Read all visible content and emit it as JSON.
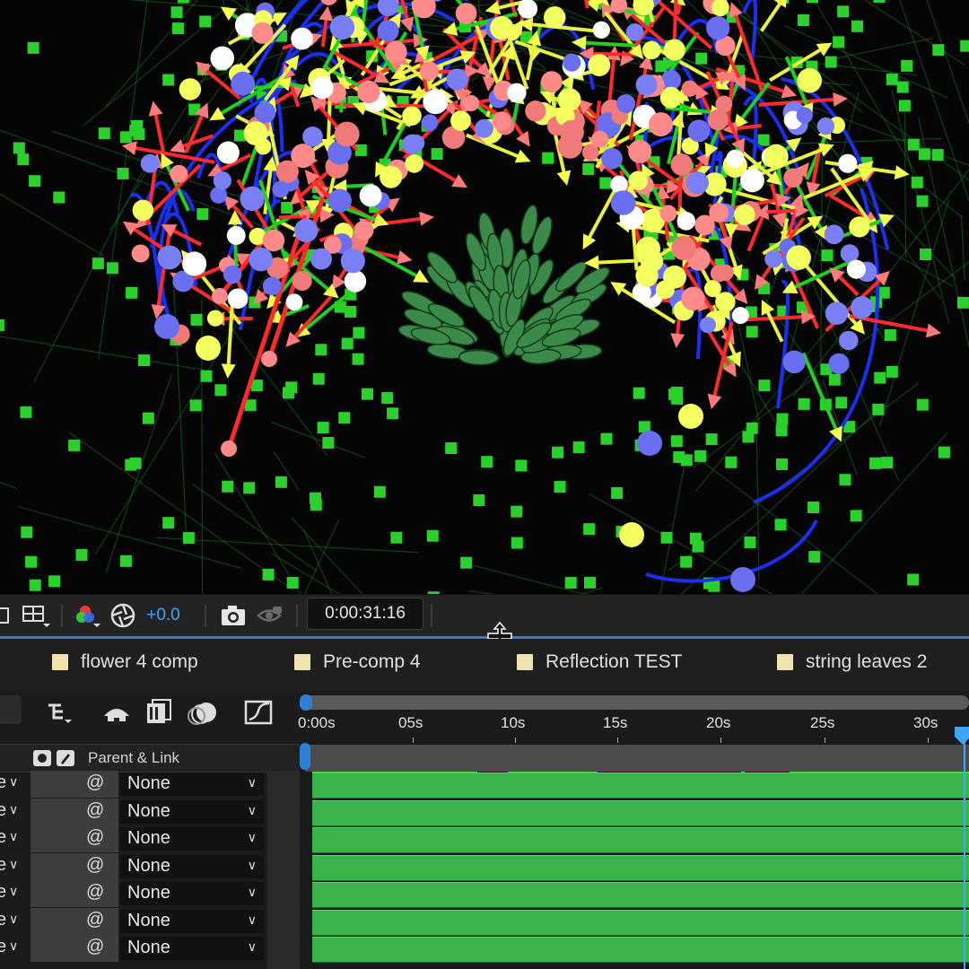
{
  "viewer_toolbar": {
    "exposure_value": "+0.0",
    "current_time": "0:00:31:16",
    "icons": [
      "region-of-interest-icon",
      "transparency-grid-icon",
      "channel-color-icon",
      "reset-exposure-icon",
      "snapshot-camera-icon",
      "show-snapshot-icon"
    ]
  },
  "comp_tabs": [
    {
      "label": "flower 4 comp",
      "color": "#efe4b0"
    },
    {
      "label": "Pre-comp 4",
      "color": "#efe4b0"
    },
    {
      "label": "Reflection TEST",
      "color": "#efe4b0"
    },
    {
      "label": "string leaves 2",
      "color": "#efe4b0"
    }
  ],
  "layer_panel": {
    "column_header": "Parent & Link",
    "edge_char": "e",
    "rows": [
      {
        "parent": "None"
      },
      {
        "parent": "None"
      },
      {
        "parent": "None"
      },
      {
        "parent": "None"
      },
      {
        "parent": "None"
      },
      {
        "parent": "None"
      },
      {
        "parent": "None"
      }
    ]
  },
  "timeline": {
    "ruler_labels": [
      "0:00s",
      "05s",
      "10s",
      "15s",
      "20s",
      "25s",
      "30s"
    ],
    "accent_color": "#2e7fd6",
    "layer_bar_color": "#3ab34a"
  }
}
